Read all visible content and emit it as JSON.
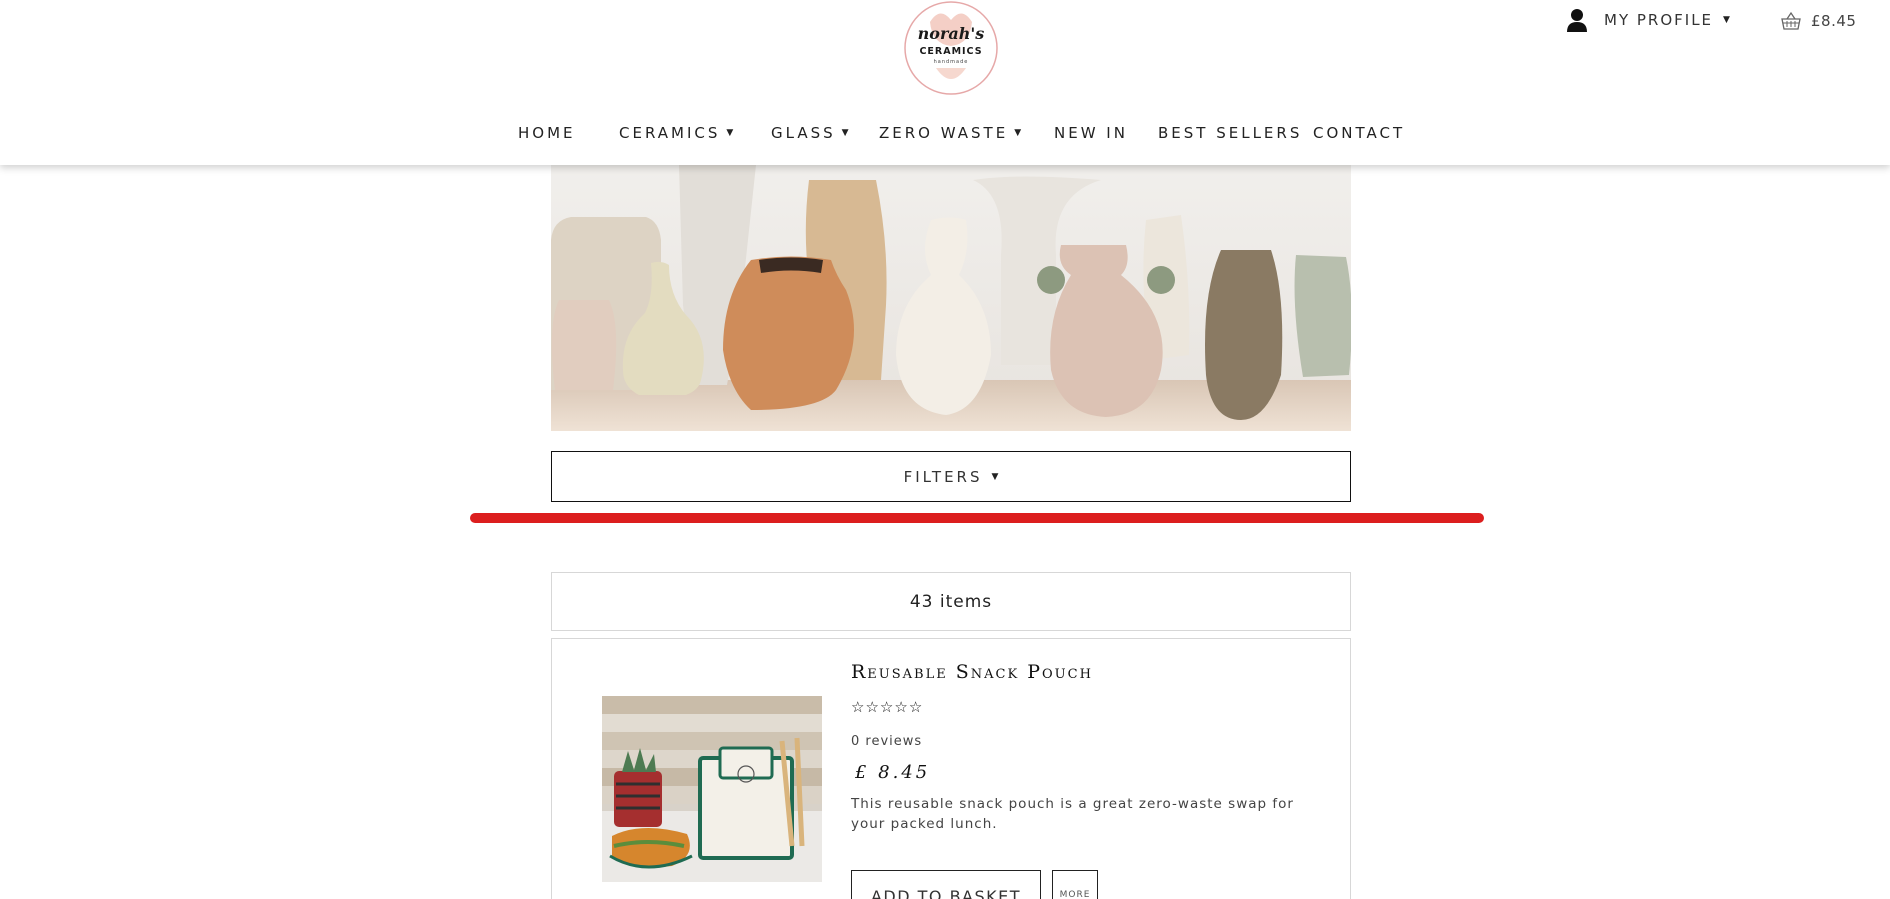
{
  "brand": {
    "logo_top": "norah's",
    "logo_middle": "CERAMICS",
    "logo_bottom": "handmade"
  },
  "header": {
    "profile_label": "MY PROFILE",
    "basket_amount": "£8.45",
    "profile_icon": "user-icon",
    "basket_icon": "basket-icon",
    "dropdown_caret": "▼"
  },
  "nav": {
    "items": [
      {
        "label": "HOME",
        "has_dropdown": false
      },
      {
        "label": "CERAMICS",
        "has_dropdown": true
      },
      {
        "label": "GLASS",
        "has_dropdown": true
      },
      {
        "label": "ZERO WASTE",
        "has_dropdown": true
      },
      {
        "label": "NEW IN",
        "has_dropdown": false
      },
      {
        "label": "BEST SELLERS",
        "has_dropdown": false
      },
      {
        "label": "CONTACT",
        "has_dropdown": false
      }
    ]
  },
  "filters": {
    "label": "FILTERS"
  },
  "listing": {
    "count_label": "43 items"
  },
  "product": {
    "title": "Reusable Snack Pouch",
    "rating": 0,
    "rating_max": 5,
    "reviews_label": "0 reviews",
    "price": "£ 8.45",
    "description": "This reusable snack pouch is a great zero-waste swap for your packed lunch.",
    "add_button_label": "ADD TO BASKET",
    "more_button_label": "MORE"
  },
  "colors": {
    "accent_red": "#dc1e1e",
    "logo_pink": "#f2c6bd",
    "pouch_green": "#1f6b52"
  }
}
